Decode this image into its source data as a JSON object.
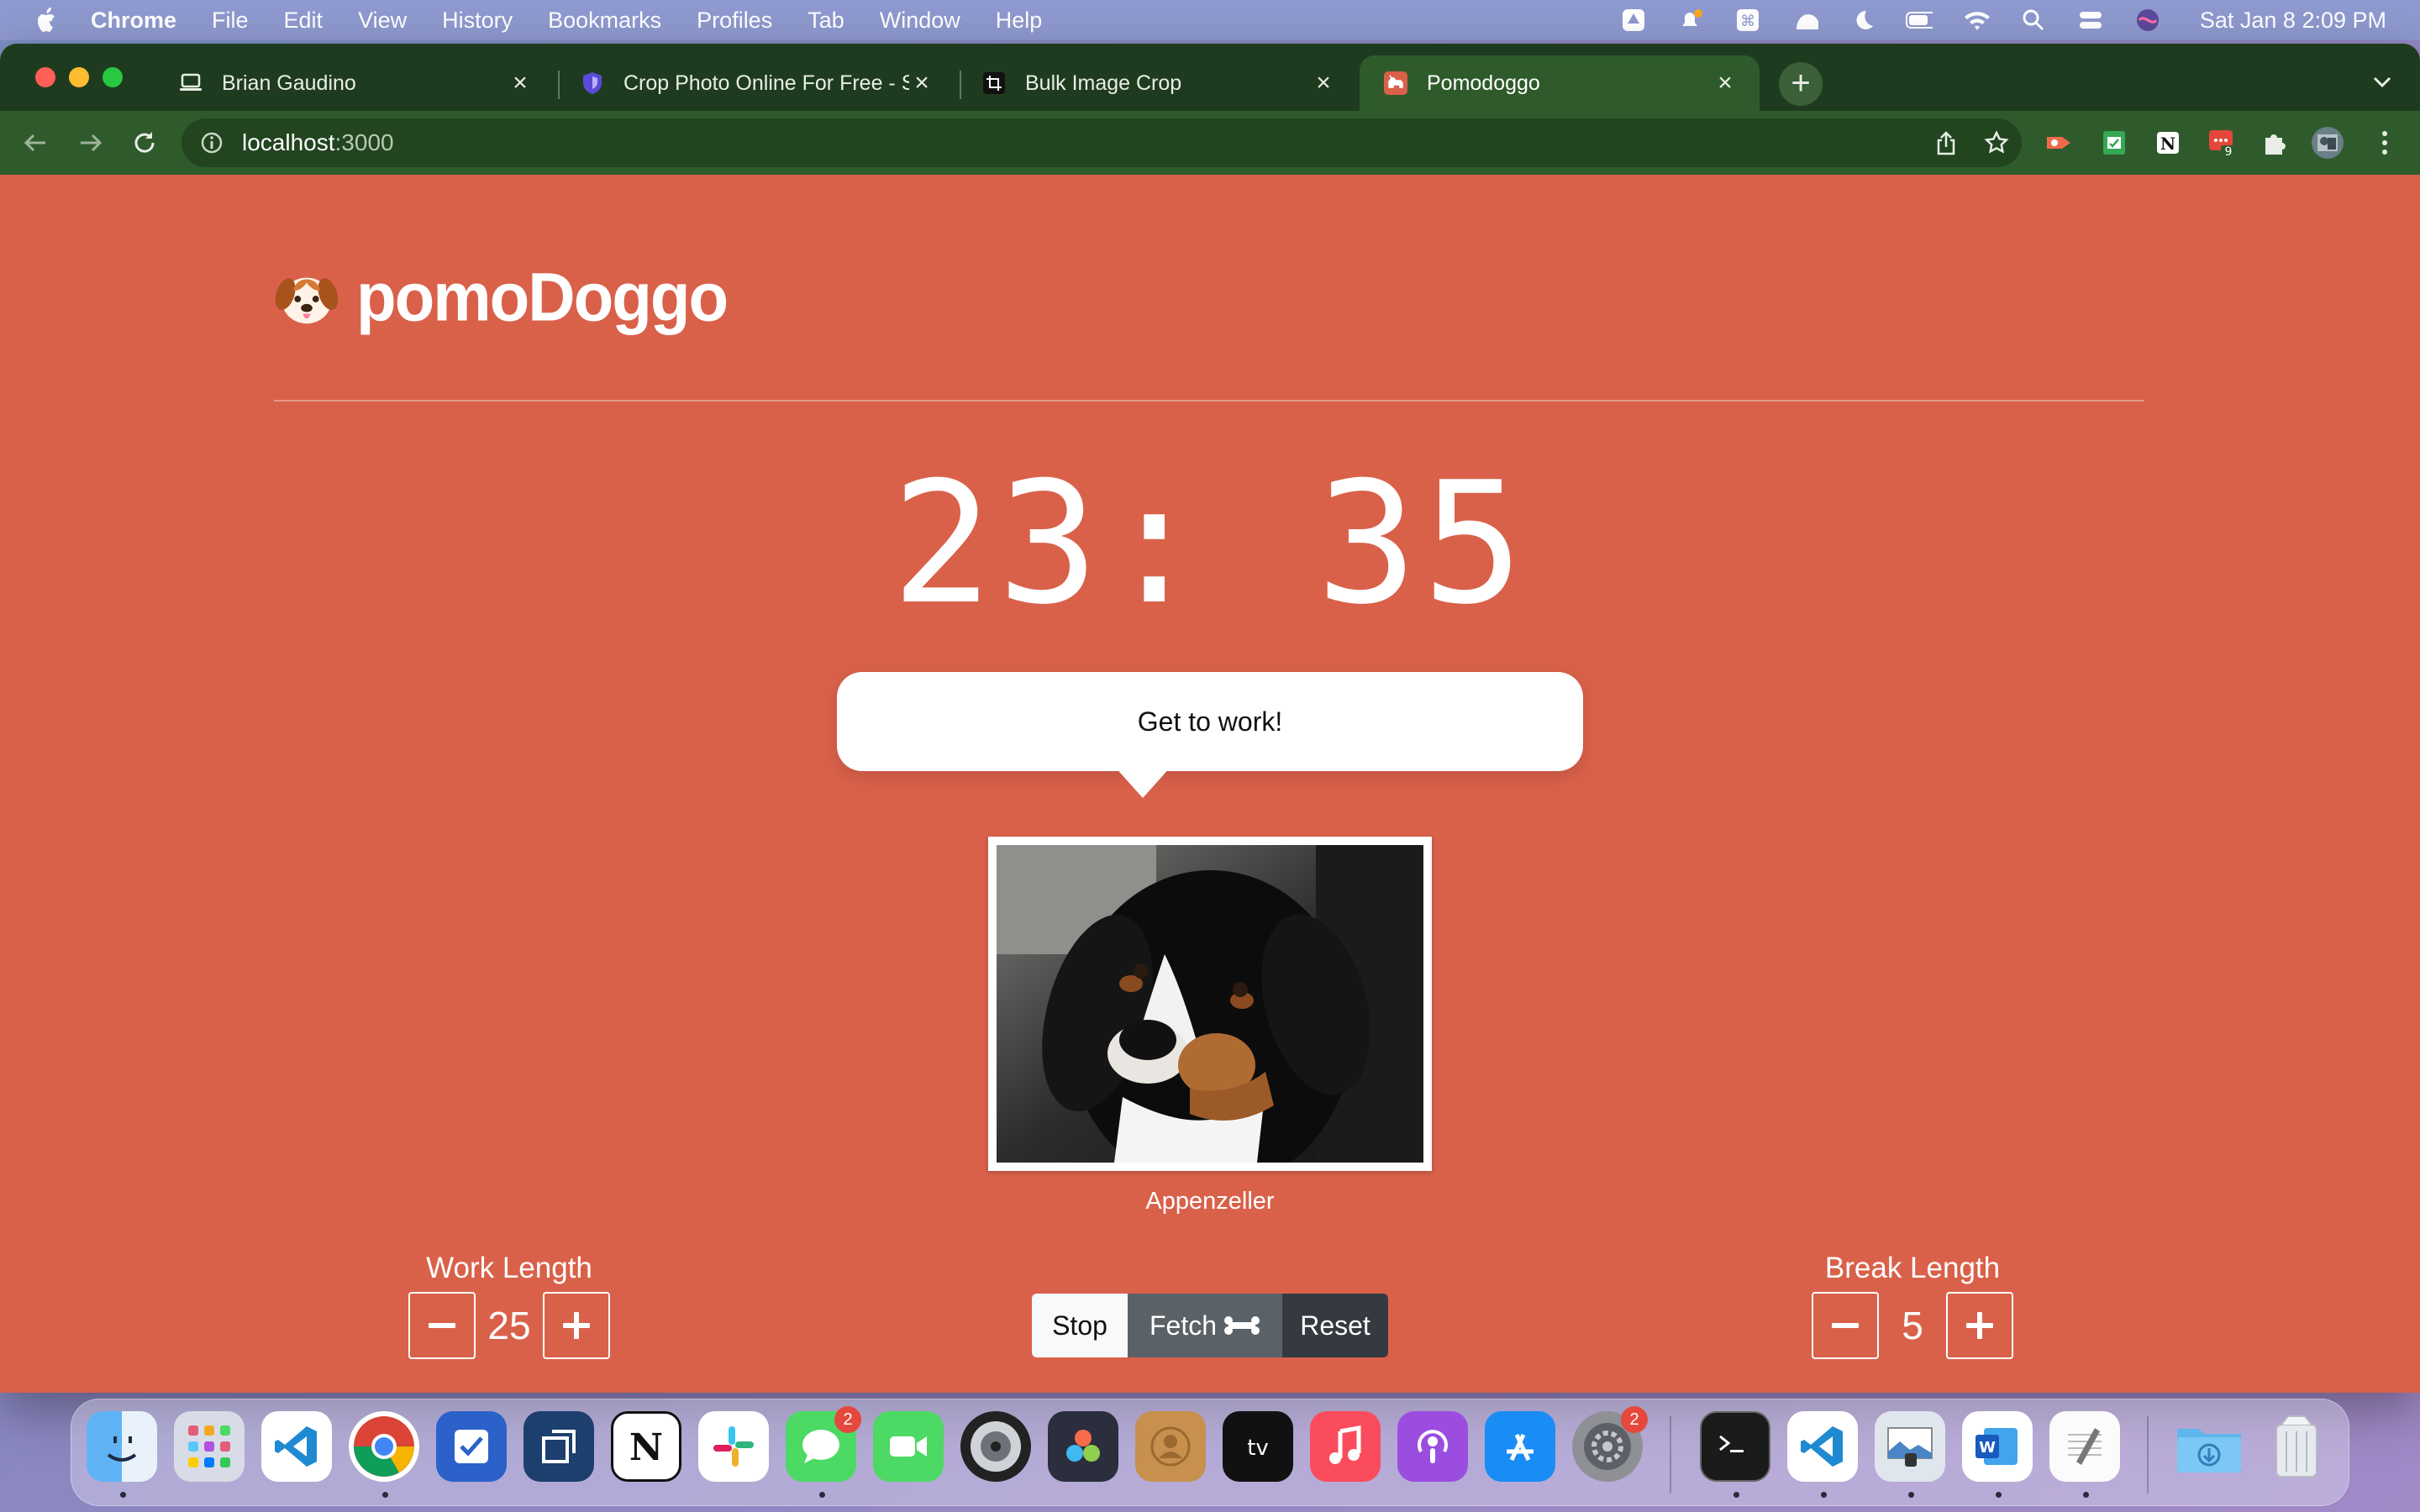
{
  "menubar": {
    "app_name": "Chrome",
    "items": [
      "File",
      "Edit",
      "View",
      "History",
      "Bookmarks",
      "Profiles",
      "Tab",
      "Window",
      "Help"
    ],
    "clock": "Sat Jan 8  2:09 PM"
  },
  "tabs": [
    {
      "title": "Brian Gaudino",
      "icon": "laptop-icon"
    },
    {
      "title": "Crop Photo Online For Free - S",
      "icon": "shield-icon"
    },
    {
      "title": "Bulk Image Crop",
      "icon": "crop-icon"
    },
    {
      "title": "Pomodoggo",
      "icon": "dog-icon",
      "active": true
    }
  ],
  "address": {
    "host": "localhost",
    "port": ":3000"
  },
  "extensions": {
    "badge_count": "9"
  },
  "app": {
    "brand": "pomoDoggo",
    "timer": "23: 35",
    "message": "Get to work!",
    "dog_breed": "Appenzeller",
    "work": {
      "label": "Work Length",
      "value": "25"
    },
    "break": {
      "label": "Break Length",
      "value": "5"
    },
    "buttons": {
      "stop": "Stop",
      "fetch": "Fetch",
      "reset": "Reset"
    }
  },
  "dock": {
    "apps": [
      "Finder",
      "Launchpad",
      "Visual Studio Code",
      "Google Chrome",
      "Tasks",
      "Screens",
      "Notion",
      "Slack",
      "Messages",
      "FaceTime",
      "Logic",
      "DaVinci Resolve",
      "Contacts",
      "Apple TV",
      "Music",
      "Podcasts",
      "App Store",
      "System Preferences",
      "Terminal",
      "Visual Studio Code",
      "Preview",
      "Microsoft Word",
      "TextEdit",
      "Downloads",
      "Trash"
    ],
    "messages_badge": "2",
    "prefs_badge": "2"
  },
  "colors": {
    "page_background": "#d9614a",
    "chrome_frame": "#1f3b1f",
    "chrome_toolbar": "#2f5b2c"
  }
}
